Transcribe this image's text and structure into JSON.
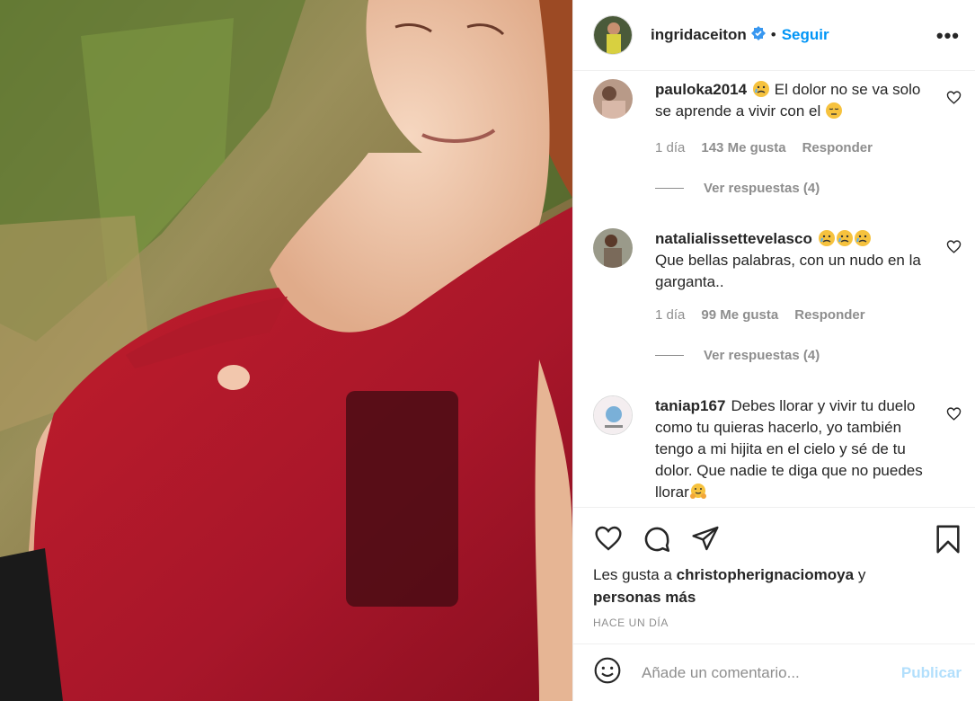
{
  "post": {
    "author": "ingridaceiton",
    "verified": true,
    "separator": "•",
    "follow_label": "Seguir",
    "more_label": "•••"
  },
  "comments": [
    {
      "username": "pauloka2014",
      "text_a": "El dolor no se va solo se aprende a vivir con el",
      "emojis": [
        "crying-face",
        "pensive-face"
      ],
      "time": "1 día",
      "likes": "143 Me gusta",
      "reply_label": "Responder",
      "view_replies": "Ver respuestas (4)"
    },
    {
      "username": "natalialissettevelasco",
      "text_a": "Que bellas palabras, con un nudo en la garganta..",
      "emojis": [
        "crying-face",
        "crying-face",
        "crying-face"
      ],
      "time": "1 día",
      "likes": "99 Me gusta",
      "reply_label": "Responder",
      "view_replies": "Ver respuestas (4)"
    },
    {
      "username": "taniap167",
      "text_a": "Debes llorar y vivir tu duelo como tu quieras hacerlo, yo también tengo a mi hijita en el cielo y sé de tu dolor. Que nadie te diga que no puedes llorar",
      "emojis": [
        "hugging-face"
      ]
    }
  ],
  "likes": {
    "prefix": "Les gusta a",
    "user": "christopherignaciomoya",
    "connector": "y",
    "others": "personas más"
  },
  "timestamp": "HACE UN DÍA",
  "comment_box": {
    "placeholder": "Añade un comentario...",
    "publish_label": "Publicar"
  },
  "colors": {
    "accent": "#0095f6",
    "publish_disabled": "#b2dffc",
    "muted": "#8e8e8e",
    "text": "#262626"
  }
}
